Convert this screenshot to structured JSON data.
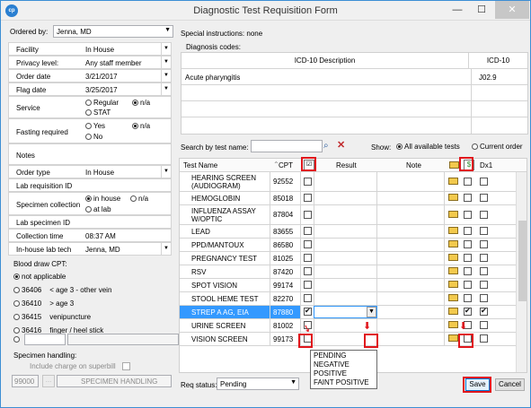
{
  "window": {
    "title": "Diagnostic Test Requisition Form",
    "app_icon": "cp"
  },
  "ordered_by": {
    "label": "Ordered by:",
    "value": "Jenna, MD"
  },
  "special_instructions": "Special instructions: none",
  "fields": [
    {
      "label": "Facility",
      "value": "In House",
      "dropdown": true
    },
    {
      "label": "Privacy level:",
      "value": "Any staff member",
      "dropdown": true
    },
    {
      "label": "Order date",
      "value": "3/21/2017",
      "dropdown": true
    },
    {
      "label": "Flag date",
      "value": "3/25/2017",
      "dropdown": true
    }
  ],
  "service": {
    "label": "Service",
    "opt1": "Regular",
    "opt2": "n/a",
    "opt3": "STAT"
  },
  "fasting": {
    "label": "Fasting required",
    "opt1": "Yes",
    "opt2": "n/a",
    "opt3": "No"
  },
  "notes": {
    "label": "Notes"
  },
  "order_type": {
    "label": "Order type",
    "value": "In House"
  },
  "lab_req": {
    "label": "Lab requisition ID"
  },
  "specimen_collection": {
    "label": "Specimen collection",
    "opt1": "in house",
    "opt2": "n/a",
    "opt3": "at lab"
  },
  "lab_specimen": {
    "label": "Lab specimen ID"
  },
  "collection_time": {
    "label": "Collection time",
    "value": "08:37 AM"
  },
  "lab_tech": {
    "label": "In-house lab tech",
    "value": "Jenna, MD"
  },
  "blood_draw": {
    "label": "Blood draw CPT:",
    "options": [
      {
        "code": "not applicable",
        "desc": "",
        "selected": true
      },
      {
        "code": "36406",
        "desc": "< age 3 - other vein",
        "selected": false
      },
      {
        "code": "36410",
        "desc": "> age 3",
        "selected": false
      },
      {
        "code": "36415",
        "desc": "venipuncture",
        "selected": false
      },
      {
        "code": "36416",
        "desc": "finger / heel stick",
        "selected": false
      }
    ]
  },
  "specimen_handling": {
    "label": "Specimen handling:",
    "include": "Include charge on superbill",
    "code": "99000",
    "desc": "SPECIMEN HANDLING"
  },
  "diagnosis": {
    "label": "Diagnosis codes:",
    "col1": "ICD-10 Description",
    "col2": "ICD-10",
    "rows": [
      {
        "desc": "Acute pharyngitis",
        "code": "J02.9"
      }
    ]
  },
  "search": {
    "label": "Search by test name:",
    "show_label": "Show:",
    "opt_all": "All available tests",
    "opt_current": "Current order"
  },
  "test_table": {
    "headers": {
      "name": "Test Name",
      "cpt": "CPT",
      "result": "Result",
      "note": "Note",
      "last": "Dx1"
    },
    "rows": [
      {
        "name": "HEARING SCREEN (AUDIOGRAM)",
        "cpt": "92552",
        "checked": false,
        "dx": false,
        "dx1": false
      },
      {
        "name": "HEMOGLOBIN",
        "cpt": "85018",
        "checked": false,
        "dx": false,
        "dx1": false
      },
      {
        "name": "INFLUENZA ASSAY W/OPTIC",
        "cpt": "87804",
        "checked": false,
        "dx": false,
        "dx1": false
      },
      {
        "name": "LEAD",
        "cpt": "83655",
        "checked": false,
        "dx": false,
        "dx1": false
      },
      {
        "name": "PPD/MANTOUX",
        "cpt": "86580",
        "checked": false,
        "dx": false,
        "dx1": false
      },
      {
        "name": "PREGNANCY TEST",
        "cpt": "81025",
        "checked": false,
        "dx": false,
        "dx1": false
      },
      {
        "name": "RSV",
        "cpt": "87420",
        "checked": false,
        "dx": false,
        "dx1": false
      },
      {
        "name": "SPOT VISION",
        "cpt": "99174",
        "checked": false,
        "dx": false,
        "dx1": false
      },
      {
        "name": "STOOL HEME TEST",
        "cpt": "82270",
        "checked": false,
        "dx": false,
        "dx1": false
      },
      {
        "name": "STREP A AG, EIA",
        "cpt": "87880",
        "checked": true,
        "dx": true,
        "dx1": true,
        "selected": true
      },
      {
        "name": "URINE SCREEN",
        "cpt": "81002",
        "checked": false,
        "dx": false,
        "dx1": false
      },
      {
        "name": "VISION SCREEN",
        "cpt": "99173",
        "checked": false,
        "dx": false,
        "dx1": false
      }
    ],
    "result_options": [
      "PENDING",
      "NEGATIVE",
      "POSITIVE",
      "FAINT POSITIVE"
    ]
  },
  "req_status": {
    "label": "Req status:",
    "value": "Pending"
  },
  "buttons": {
    "save": "Save",
    "cancel": "Cancel"
  },
  "colors": {
    "highlight": "#e0161c",
    "selection": "#3399ff"
  }
}
